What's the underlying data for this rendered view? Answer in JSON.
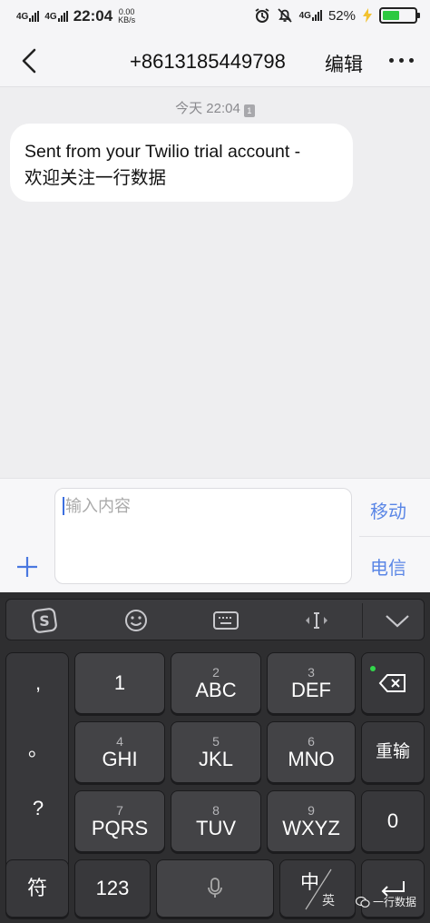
{
  "status": {
    "net1": "4G",
    "net2": "4G",
    "time": "22:04",
    "speed_value": "0.00",
    "speed_unit": "KB/s",
    "net3": "4G",
    "battery": "52%",
    "battery_level": 0.52
  },
  "header": {
    "title": "+8613185449798",
    "edit_label": "编辑"
  },
  "chat": {
    "timestamp": "今天 22:04",
    "sim_badge": "1",
    "message_line1": "Sent from your Twilio trial account -",
    "message_line2": "欢迎关注一行数据"
  },
  "input": {
    "placeholder": "输入内容",
    "send_mobile": "移动",
    "send_telecom": "电信"
  },
  "keyboard": {
    "punct": [
      ",",
      "。",
      "?",
      "!"
    ],
    "keys": [
      {
        "num": "",
        "main": "1"
      },
      {
        "num": "2",
        "main": "ABC"
      },
      {
        "num": "3",
        "main": "DEF"
      },
      {
        "num": "4",
        "main": "GHI"
      },
      {
        "num": "5",
        "main": "JKL"
      },
      {
        "num": "6",
        "main": "MNO"
      },
      {
        "num": "7",
        "main": "PQRS"
      },
      {
        "num": "8",
        "main": "TUV"
      },
      {
        "num": "9",
        "main": "WXYZ"
      }
    ],
    "reenter": "重输",
    "zero": "0",
    "symbols": "符",
    "numbers": "123",
    "lang_primary": "中",
    "lang_secondary": "英"
  },
  "watermark": "一行数据",
  "colors": {
    "accent_blue": "#5a86e6",
    "battery_green": "#2cc940",
    "keyboard_bg": "#2e2e30"
  }
}
